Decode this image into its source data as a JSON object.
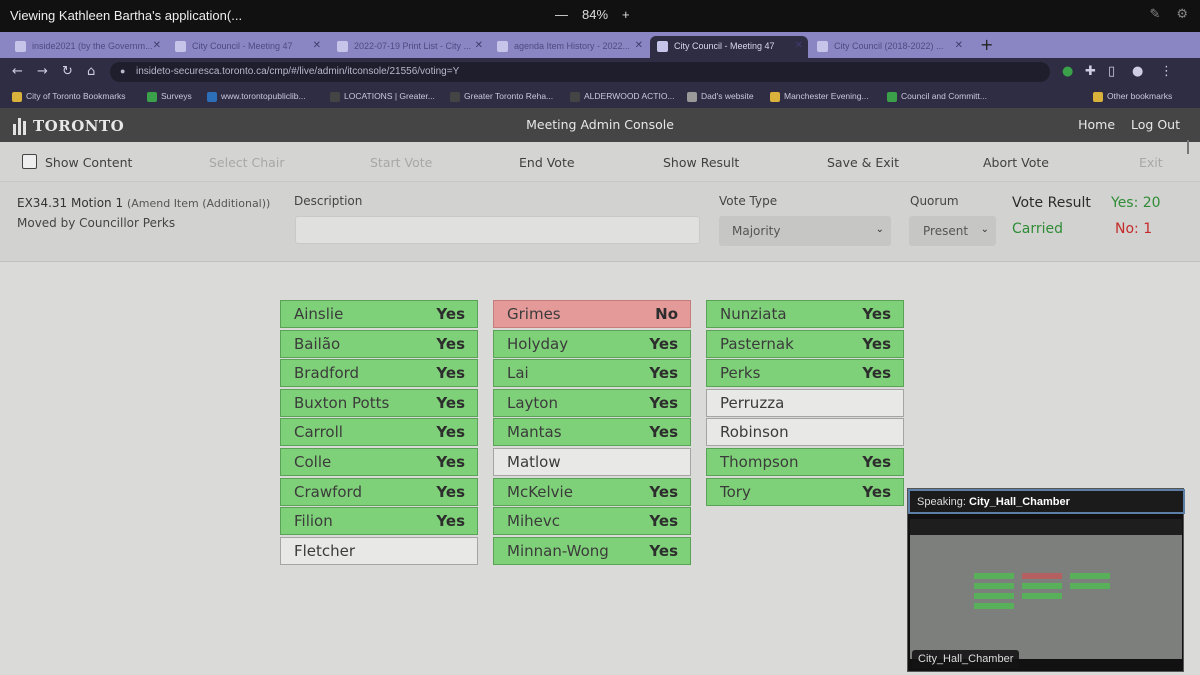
{
  "share_bar": {
    "title": "Viewing Kathleen Bartha's application(...",
    "zoom_minus": "—",
    "zoom": "84%",
    "zoom_plus": "+"
  },
  "browser": {
    "tabs": [
      {
        "label": "inside2021 (by the Governm...",
        "active": false
      },
      {
        "label": "City Council - Meeting 47",
        "active": false
      },
      {
        "label": "2022-07-19 Print List - City ...",
        "active": false
      },
      {
        "label": "agenda Item History - 2022...",
        "active": false
      },
      {
        "label": "City Council - Meeting 47",
        "active": true
      },
      {
        "label": "City Council (2018-2022) ...",
        "active": false
      }
    ],
    "url": "insideto-securesca.toronto.ca/cmp/#/live/admin/itconsole/21556/voting=Y",
    "bookmarks": [
      {
        "label": "City of Toronto Bookmarks",
        "color": "#d8b23a"
      },
      {
        "label": "Surveys",
        "color": "#3aa04a"
      },
      {
        "label": "www.torontopubliclib...",
        "color": "#2c6fb8"
      },
      {
        "label": "LOCATIONS | Greater...",
        "color": "#444"
      },
      {
        "label": "Greater Toronto Reha...",
        "color": "#444"
      },
      {
        "label": "ALDERWOOD ACTIO...",
        "color": "#444"
      },
      {
        "label": "Dad's website",
        "color": "#999"
      },
      {
        "label": "Manchester Evening...",
        "color": "#d8b23a"
      },
      {
        "label": "Council and Committ...",
        "color": "#3aa04a"
      },
      {
        "label": "Other bookmarks",
        "color": "#d8b23a"
      }
    ]
  },
  "header": {
    "logo": "TORONTO",
    "title": "Meeting Admin Console",
    "home": "Home",
    "logout": "Log Out"
  },
  "actions": {
    "show_content": "Show Content",
    "select_chair": "Select Chair",
    "start_vote": "Start Vote",
    "end_vote": "End Vote",
    "show_result": "Show Result",
    "save_exit": "Save & Exit",
    "abort_vote": "Abort Vote",
    "exit": "Exit"
  },
  "motion": {
    "id": "EX34.31 Motion 1",
    "desc": "(Amend Item (Additional))",
    "moved_by": "Moved by Councillor Perks",
    "description_label": "Description",
    "description_value": "",
    "vote_type_label": "Vote Type",
    "vote_type": "Majority",
    "quorum_label": "Quorum",
    "quorum": "Present",
    "result_label": "Vote Result",
    "yes": "Yes: 20",
    "outcome": "Carried",
    "no": "No: 1"
  },
  "votes": [
    [
      {
        "name": "Ainslie",
        "vote": "Yes"
      },
      {
        "name": "Bailão",
        "vote": "Yes"
      },
      {
        "name": "Bradford",
        "vote": "Yes"
      },
      {
        "name": "Buxton Potts",
        "vote": "Yes"
      },
      {
        "name": "Carroll",
        "vote": "Yes"
      },
      {
        "name": "Colle",
        "vote": "Yes"
      },
      {
        "name": "Crawford",
        "vote": "Yes"
      },
      {
        "name": "Filion",
        "vote": "Yes"
      },
      {
        "name": "Fletcher",
        "vote": ""
      }
    ],
    [
      {
        "name": "Grimes",
        "vote": "No"
      },
      {
        "name": "Holyday",
        "vote": "Yes"
      },
      {
        "name": "Lai",
        "vote": "Yes"
      },
      {
        "name": "Layton",
        "vote": "Yes"
      },
      {
        "name": "Mantas",
        "vote": "Yes"
      },
      {
        "name": "Matlow",
        "vote": ""
      },
      {
        "name": "McKelvie",
        "vote": "Yes"
      },
      {
        "name": "Mihevc",
        "vote": "Yes"
      },
      {
        "name": "Minnan-Wong",
        "vote": "Yes"
      }
    ],
    [
      {
        "name": "Nunziata",
        "vote": "Yes"
      },
      {
        "name": "Pasternak",
        "vote": "Yes"
      },
      {
        "name": "Perks",
        "vote": "Yes"
      },
      {
        "name": "Perruzza",
        "vote": ""
      },
      {
        "name": "Robinson",
        "vote": ""
      },
      {
        "name": "Thompson",
        "vote": "Yes"
      },
      {
        "name": "Tory",
        "vote": "Yes"
      }
    ]
  ],
  "speaker": {
    "prefix": "Speaking:",
    "name": "City_Hall_Chamber",
    "camera_label": "City_Hall_Chamber"
  }
}
